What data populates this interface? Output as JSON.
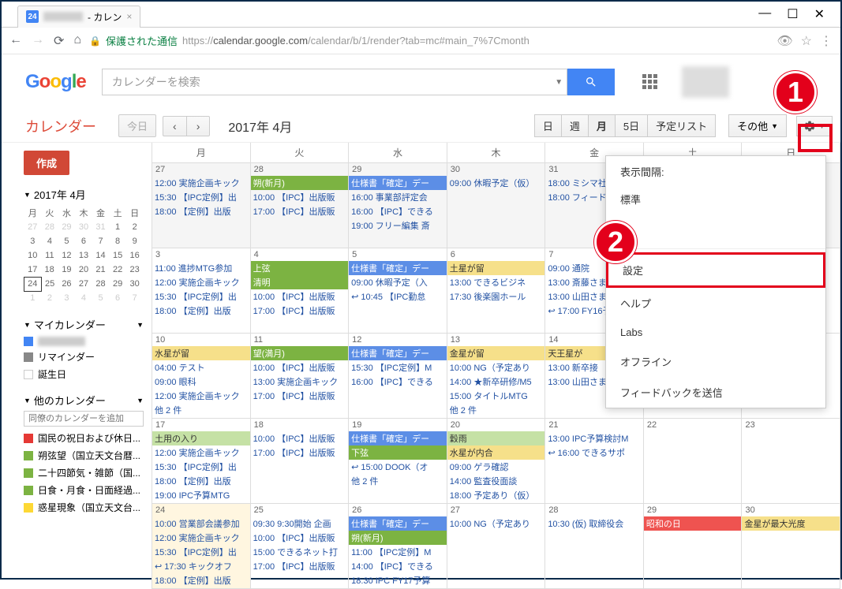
{
  "browser": {
    "tab_favicon": "24",
    "tab_title": "- カレン",
    "url_secure": "保護された通信",
    "url": "https://calendar.google.com/calendar/b/1/render?tab=mc#main_7%7Cmonth"
  },
  "header": {
    "logo": "Google",
    "search_placeholder": "カレンダーを検索"
  },
  "toolbar": {
    "app_name": "カレンダー",
    "today": "今日",
    "month_label": "2017年 4月",
    "views": [
      "日",
      "週",
      "月",
      "5日",
      "予定リスト"
    ],
    "active_view": "月",
    "other": "その他"
  },
  "sidebar": {
    "create": "作成",
    "mini_month": "2017年 4月",
    "weekdays": [
      "月",
      "火",
      "水",
      "木",
      "金",
      "土",
      "日"
    ],
    "mini_days": [
      [
        "27",
        "28",
        "29",
        "30",
        "31",
        "1",
        "2"
      ],
      [
        "3",
        "4",
        "5",
        "6",
        "7",
        "8",
        "9"
      ],
      [
        "10",
        "11",
        "12",
        "13",
        "14",
        "15",
        "16"
      ],
      [
        "17",
        "18",
        "19",
        "20",
        "21",
        "22",
        "23"
      ],
      [
        "24",
        "25",
        "26",
        "27",
        "28",
        "29",
        "30"
      ],
      [
        "1",
        "2",
        "3",
        "4",
        "5",
        "6",
        "7"
      ]
    ],
    "today_day": "24",
    "my_cal_label": "マイカレンダー",
    "my_cals": [
      {
        "color": "#4285f4",
        "name": "",
        "blur": true
      },
      {
        "color": "#888",
        "name": "リマインダー"
      },
      {
        "color": "#fff",
        "name": "誕生日",
        "border": true
      }
    ],
    "other_cal_label": "他のカレンダー",
    "add_placeholder": "同僚のカレンダーを追加",
    "other_cals": [
      {
        "color": "#e53935",
        "name": "国民の祝日および休日..."
      },
      {
        "color": "#7cb342",
        "name": "朔弦望（国立天文台暦..."
      },
      {
        "color": "#7cb342",
        "name": "二十四節気・雑節（国..."
      },
      {
        "color": "#7cb342",
        "name": "日食・月食・日面経過..."
      },
      {
        "color": "#fdd835",
        "name": "惑星現象（国立天文台..."
      }
    ]
  },
  "calendar": {
    "day_headers": [
      "月",
      "火",
      "水",
      "木",
      "金",
      "土",
      "日"
    ],
    "weeks": [
      {
        "cells": [
          {
            "date": "27",
            "dim": true,
            "events": [
              {
                "type": "link",
                "text": "12:00 実施企画キック"
              },
              {
                "type": "link",
                "text": "15:30 【IPC定例】出"
              },
              {
                "type": "link",
                "text": "18:00 【定例】出版"
              }
            ]
          },
          {
            "date": "28",
            "dim": true,
            "events": [
              {
                "type": "green",
                "text": "朔(新月)"
              },
              {
                "type": "link",
                "text": "10:00 【IPC】出版販"
              },
              {
                "type": "link",
                "text": "17:00 【IPC】出版販"
              }
            ]
          },
          {
            "date": "29",
            "dim": true,
            "events": [
              {
                "type": "blue",
                "text": "仕様書「確定」デー"
              },
              {
                "type": "link",
                "text": "16:00 事業部評定会"
              },
              {
                "type": "link",
                "text": "16:00 【IPC】できる"
              },
              {
                "type": "link",
                "text": "19:00 フリー編集 斎"
              }
            ]
          },
          {
            "date": "30",
            "dim": true,
            "events": [
              {
                "type": "link",
                "text": "09:00 休暇予定（仮）"
              }
            ]
          },
          {
            "date": "31",
            "dim": true,
            "events": [
              {
                "type": "link",
                "text": "18:00 ミシマ社さ"
              },
              {
                "type": "link",
                "text": "18:00 フィード"
              }
            ]
          },
          {
            "date": "",
            "dim": true,
            "events": []
          },
          {
            "date": "",
            "dim": true,
            "events": []
          }
        ]
      },
      {
        "cells": [
          {
            "date": "3",
            "events": [
              {
                "type": "link",
                "text": "11:00 進捗MTG参加"
              },
              {
                "type": "link",
                "text": "12:00 実施企画キック"
              },
              {
                "type": "link",
                "text": "15:30 【IPC定例】出"
              },
              {
                "type": "link",
                "text": "18:00 【定例】出版"
              }
            ]
          },
          {
            "date": "4",
            "events": [
              {
                "type": "green",
                "text": "上弦"
              },
              {
                "type": "green",
                "text": "清明"
              },
              {
                "type": "link",
                "text": "10:00 【IPC】出版販"
              },
              {
                "type": "link",
                "text": "17:00 【IPC】出版販"
              }
            ]
          },
          {
            "date": "5",
            "events": [
              {
                "type": "blue",
                "text": "仕様書「確定」デー"
              },
              {
                "type": "link",
                "text": "09:00 休暇予定（入"
              },
              {
                "type": "link",
                "text": "↩ 10:45 【IPC勤怠"
              }
            ]
          },
          {
            "date": "6",
            "events": [
              {
                "type": "yellow",
                "text": "土星が留"
              },
              {
                "type": "link",
                "text": "13:00 できるビジネ"
              },
              {
                "type": "link",
                "text": "17:30 後楽園ホール"
              }
            ]
          },
          {
            "date": "7",
            "events": [
              {
                "type": "link",
                "text": "09:00 通院"
              },
              {
                "type": "link",
                "text": "13:00 斎藤さま"
              },
              {
                "type": "link",
                "text": "13:00 山田さまご"
              },
              {
                "type": "link",
                "text": "↩ 17:00 FY16予"
              }
            ]
          },
          {
            "date": "",
            "events": []
          },
          {
            "date": "",
            "events": []
          }
        ]
      },
      {
        "cells": [
          {
            "date": "10",
            "events": [
              {
                "type": "yellow",
                "text": "水星が留"
              },
              {
                "type": "link",
                "text": "04:00 テスト"
              },
              {
                "type": "link",
                "text": "09:00 眼科"
              },
              {
                "type": "link",
                "text": "12:00 実施企画キック"
              },
              {
                "type": "more",
                "text": "他 2 件"
              }
            ]
          },
          {
            "date": "11",
            "events": [
              {
                "type": "green",
                "text": "望(満月)"
              },
              {
                "type": "link",
                "text": "10:00 【IPC】出版販"
              },
              {
                "type": "link",
                "text": "13:00 実施企画キック"
              },
              {
                "type": "link",
                "text": "17:00 【IPC】出版販"
              }
            ]
          },
          {
            "date": "12",
            "events": [
              {
                "type": "blue",
                "text": "仕様書「確定」デー"
              },
              {
                "type": "link",
                "text": "15:30 【IPC定例】M"
              },
              {
                "type": "link",
                "text": "16:00 【IPC】できる"
              }
            ]
          },
          {
            "date": "13",
            "events": [
              {
                "type": "yellow",
                "text": "金星が留"
              },
              {
                "type": "link",
                "text": "10:00 NG（予定あり"
              },
              {
                "type": "link",
                "text": "14:00 ★新卒研修/M5"
              },
              {
                "type": "link",
                "text": "15:00 タイトルMTG"
              },
              {
                "type": "more",
                "text": "他 2 件"
              }
            ]
          },
          {
            "date": "14",
            "events": [
              {
                "type": "yellow",
                "text": "天王星が"
              },
              {
                "type": "link",
                "text": "13:00 新卒接"
              },
              {
                "type": "link",
                "text": "13:00 山田さまご"
              }
            ]
          },
          {
            "date": "",
            "events": []
          },
          {
            "date": "",
            "events": []
          }
        ]
      },
      {
        "cells": [
          {
            "date": "17",
            "events": [
              {
                "type": "lime",
                "text": "土用の入り"
              },
              {
                "type": "link",
                "text": "12:00 実施企画キック"
              },
              {
                "type": "link",
                "text": "15:30 【IPC定例】出"
              },
              {
                "type": "link",
                "text": "18:00 【定例】出版"
              },
              {
                "type": "link",
                "text": "19:00 IPC予算MTG"
              }
            ]
          },
          {
            "date": "18",
            "events": [
              {
                "type": "link",
                "text": "10:00 【IPC】出版販"
              },
              {
                "type": "link",
                "text": "17:00 【IPC】出版販"
              }
            ]
          },
          {
            "date": "19",
            "events": [
              {
                "type": "blue",
                "text": "仕様書「確定」デー"
              },
              {
                "type": "green",
                "text": "下弦"
              },
              {
                "type": "link",
                "text": "↩ 15:00 DOOK（オ"
              },
              {
                "type": "more",
                "text": "他 2 件"
              }
            ]
          },
          {
            "date": "20",
            "events": [
              {
                "type": "lime",
                "text": "穀雨"
              },
              {
                "type": "yellow",
                "text": "水星が内合"
              },
              {
                "type": "link",
                "text": "09:00 ゲラ確認"
              },
              {
                "type": "link",
                "text": "14:00 監査役面談"
              },
              {
                "type": "link",
                "text": "18:00 予定あり（仮）"
              }
            ]
          },
          {
            "date": "21",
            "events": [
              {
                "type": "link",
                "text": "13:00 IPC予算検討M"
              },
              {
                "type": "link",
                "text": "↩ 16:00 できるサポ"
              }
            ]
          },
          {
            "date": "22",
            "events": []
          },
          {
            "date": "23",
            "events": []
          }
        ]
      },
      {
        "cells": [
          {
            "date": "24",
            "today": true,
            "events": [
              {
                "type": "link",
                "text": "10:00 営業部会議参加"
              },
              {
                "type": "link",
                "text": "12:00 実施企画キック"
              },
              {
                "type": "link",
                "text": "15:30 【IPC定例】出"
              },
              {
                "type": "link",
                "text": "↩ 17:30 キックオフ"
              },
              {
                "type": "link",
                "text": "18:00 【定例】出版"
              }
            ]
          },
          {
            "date": "25",
            "events": [
              {
                "type": "link",
                "text": "09:30 9:30開始 企画"
              },
              {
                "type": "link",
                "text": "10:00 【IPC】出版販"
              },
              {
                "type": "link",
                "text": "15:00 できるネット打"
              },
              {
                "type": "link",
                "text": "17:00 【IPC】出版販"
              }
            ]
          },
          {
            "date": "26",
            "events": [
              {
                "type": "blue",
                "text": "仕様書「確定」デー"
              },
              {
                "type": "green",
                "text": "朔(新月)"
              },
              {
                "type": "link",
                "text": "11:00 【IPC定例】M"
              },
              {
                "type": "link",
                "text": "14:00 【IPC】できる"
              },
              {
                "type": "link",
                "text": "18:30 IPC FY17予算"
              }
            ]
          },
          {
            "date": "27",
            "events": [
              {
                "type": "link",
                "text": "10:00 NG（予定あり"
              }
            ]
          },
          {
            "date": "28",
            "events": [
              {
                "type": "link",
                "text": "10:30 (仮) 取締役会"
              }
            ]
          },
          {
            "date": "29",
            "events": [
              {
                "type": "red",
                "text": "昭和の日"
              }
            ]
          },
          {
            "date": "30",
            "events": [
              {
                "type": "yellow",
                "text": "金星が最大光度"
              }
            ]
          }
        ]
      }
    ]
  },
  "settings_menu": {
    "density_label": "表示間隔:",
    "items_top": [
      "標準",
      "小"
    ],
    "items_main": [
      "設定",
      "ヘルプ",
      "Labs",
      "オフライン",
      "フィードバックを送信"
    ],
    "highlighted": "設定"
  },
  "annotations": {
    "badge1": "1",
    "badge2": "2"
  }
}
